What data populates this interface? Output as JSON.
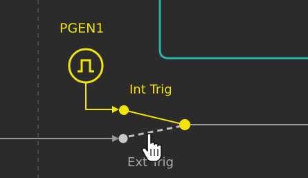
{
  "diagram": {
    "pgen_label": "PGEN1",
    "int_trig_label": "Int Trig",
    "ext_trig_label": "Ext Trig",
    "colors": {
      "background": "#2b2b2b",
      "active": "#f2e30c",
      "inactive": "#9a9a9a",
      "teal_frame": "#2bb3a8",
      "guide_dash": "#4a4a4a",
      "label_inactive": "#a8a8a8"
    },
    "icons": {
      "pulse_generator": "square-pulse-icon",
      "cursor": "hand-pointer-icon"
    }
  }
}
